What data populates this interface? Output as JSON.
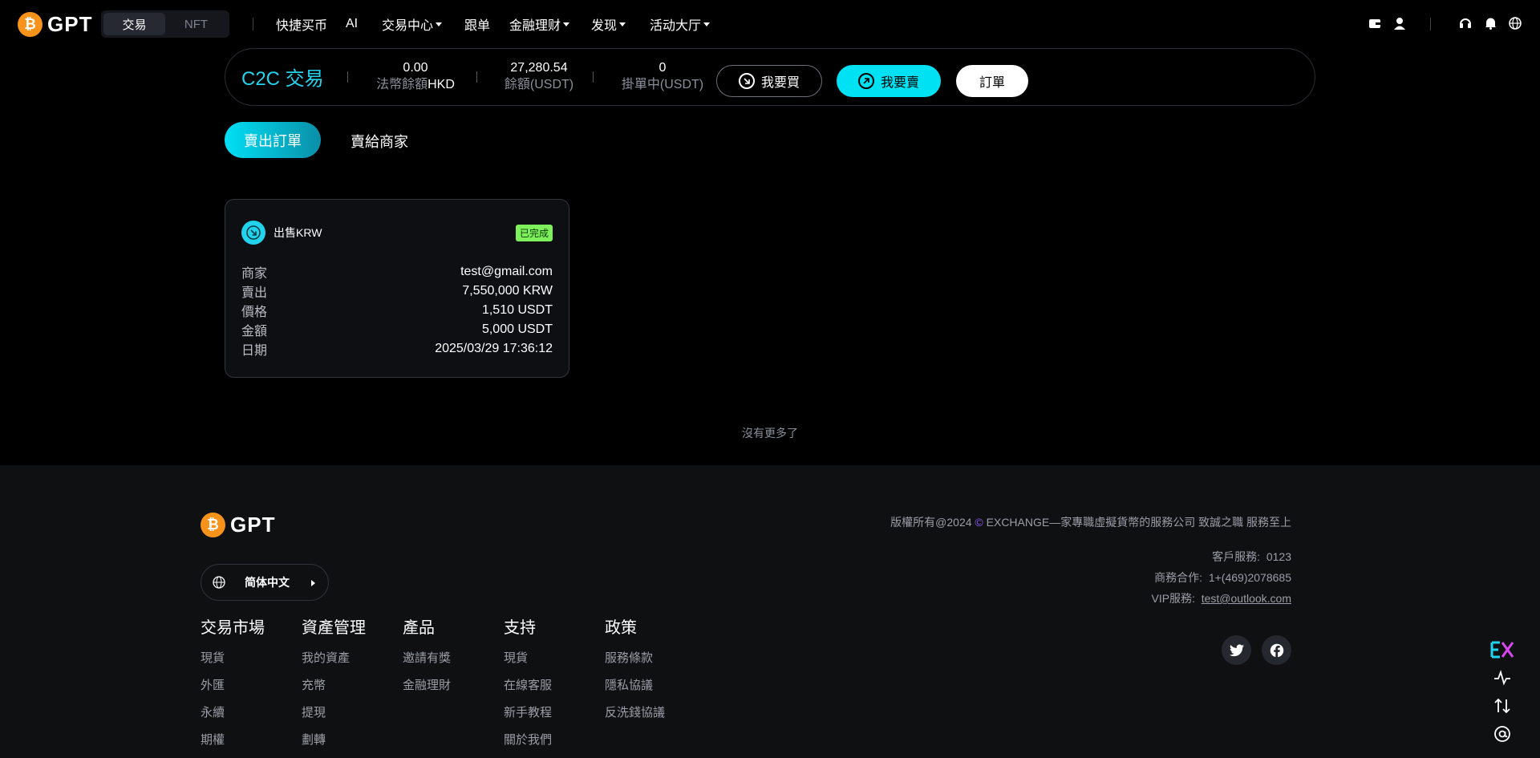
{
  "nav": {
    "logo_text": "GPT",
    "segment": [
      "交易",
      "NFT"
    ],
    "menu": [
      "快捷买币",
      "AI",
      "交易中心",
      "跟单",
      "金融理财",
      "发现",
      "活动大厅"
    ]
  },
  "summary": {
    "title": "C2C 交易",
    "stats": [
      {
        "value": "0.00",
        "label": "法幣餘額",
        "unit": "HKD"
      },
      {
        "value": "27,280.54",
        "label": "餘額(USDT)"
      },
      {
        "value": "0",
        "label": "掛單中(USDT)"
      }
    ],
    "buy_label": "我要買",
    "sell_label": "我要賣",
    "order_label": "訂單"
  },
  "tabs": [
    "賣出訂單",
    "賣給商家"
  ],
  "order": {
    "title": "出售KRW",
    "status": "已完成",
    "rows": [
      {
        "k": "商家",
        "v": "test@gmail.com"
      },
      {
        "k": "賣出",
        "v": "7,550,000 KRW"
      },
      {
        "k": "價格",
        "v": "1,510 USDT"
      },
      {
        "k": "金額",
        "v": "5,000 USDT"
      },
      {
        "k": "日期",
        "v": "2025/03/29 17:36:12"
      }
    ]
  },
  "no_more": "沒有更多了",
  "footer": {
    "logo_text": "GPT",
    "language": "简体中文",
    "copyright_pre": "版權所有@2024",
    "copyright_post": "EXCHANGE—家專職虛擬貨幣的服務公司 致誠之職 服務至上",
    "columns": [
      {
        "title": "交易市場",
        "items": [
          "現貨",
          "外匯",
          "永續",
          "期權"
        ]
      },
      {
        "title": "資產管理",
        "items": [
          "我的資產",
          "充幣",
          "提現",
          "劃轉"
        ]
      },
      {
        "title": "產品",
        "items": [
          "邀請有獎",
          "金融理財"
        ]
      },
      {
        "title": "支持",
        "items": [
          "現貨",
          "在線客服",
          "新手教程",
          "關於我們"
        ]
      },
      {
        "title": "政策",
        "items": [
          "服務條款",
          "隱私協議",
          "反洗錢協議"
        ]
      }
    ],
    "contacts": [
      {
        "label": "客戶服務:",
        "value": "0123"
      },
      {
        "label": "商務合作:",
        "value": "1+(469)2078685"
      },
      {
        "label": "VIP服務:",
        "value": "test@outlook.com"
      }
    ]
  },
  "colors": {
    "accent": "#00e1f4",
    "brand": "#f7931a",
    "success": "#7ef05c"
  }
}
